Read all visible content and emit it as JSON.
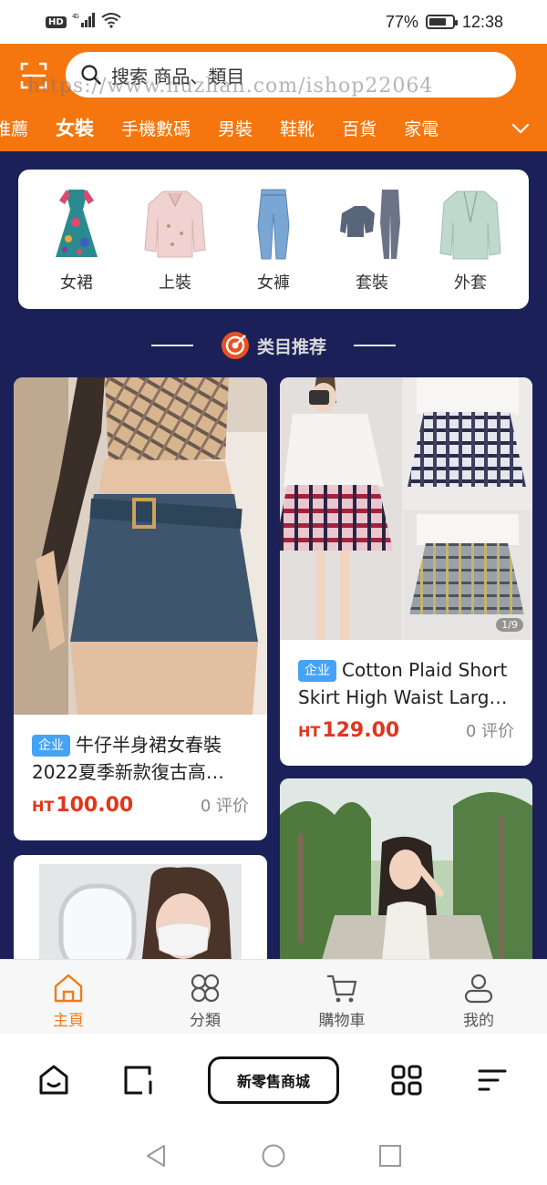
{
  "status_bar": {
    "network_label": "HD",
    "signal_label": "4G",
    "battery_text": "77%",
    "battery_level": 0.77,
    "time": "12:38"
  },
  "header": {
    "search_placeholder": "搜索 商品、類目",
    "watermark": "https://www.huzhan.com/ishop22064",
    "tabs": [
      "推薦",
      "女裝",
      "手機數碼",
      "男裝",
      "鞋靴",
      "百貨",
      "家電"
    ],
    "active_tab": "女裝"
  },
  "subcategories": [
    {
      "label": "女裙",
      "icon": "dress-icon"
    },
    {
      "label": "上裝",
      "icon": "blouse-icon"
    },
    {
      "label": "女褲",
      "icon": "jeans-icon"
    },
    {
      "label": "套裝",
      "icon": "tracksuit-icon"
    },
    {
      "label": "外套",
      "icon": "blazer-icon"
    }
  ],
  "section": {
    "title": "类目推荐",
    "icon": "target-icon"
  },
  "products": [
    {
      "badge": "企业",
      "title": "牛仔半身裙女春裝2022夏季新款復古高…",
      "currency": "HT",
      "price": "100.00",
      "reviews": "0 评价"
    },
    {
      "badge": "企业",
      "title": "Cotton Plaid Short Skirt High Waist Larg…",
      "currency": "HT",
      "price": "129.00",
      "reviews": "0 评价",
      "image_counter": "1/9"
    }
  ],
  "tabbar": {
    "items": [
      {
        "label": "主頁",
        "icon": "home-icon",
        "active": true
      },
      {
        "label": "分類",
        "icon": "category-icon",
        "active": false
      },
      {
        "label": "購物車",
        "icon": "cart-icon",
        "active": false
      },
      {
        "label": "我的",
        "icon": "profile-icon",
        "active": false
      }
    ]
  },
  "browser_bar": {
    "center_button": "新零售商城"
  },
  "colors": {
    "brand_orange": "#f5760e",
    "content_bg": "#1b2158",
    "price_red": "#e2361b",
    "badge_blue": "#45a3f5",
    "tab_active": "#f07a1b"
  }
}
